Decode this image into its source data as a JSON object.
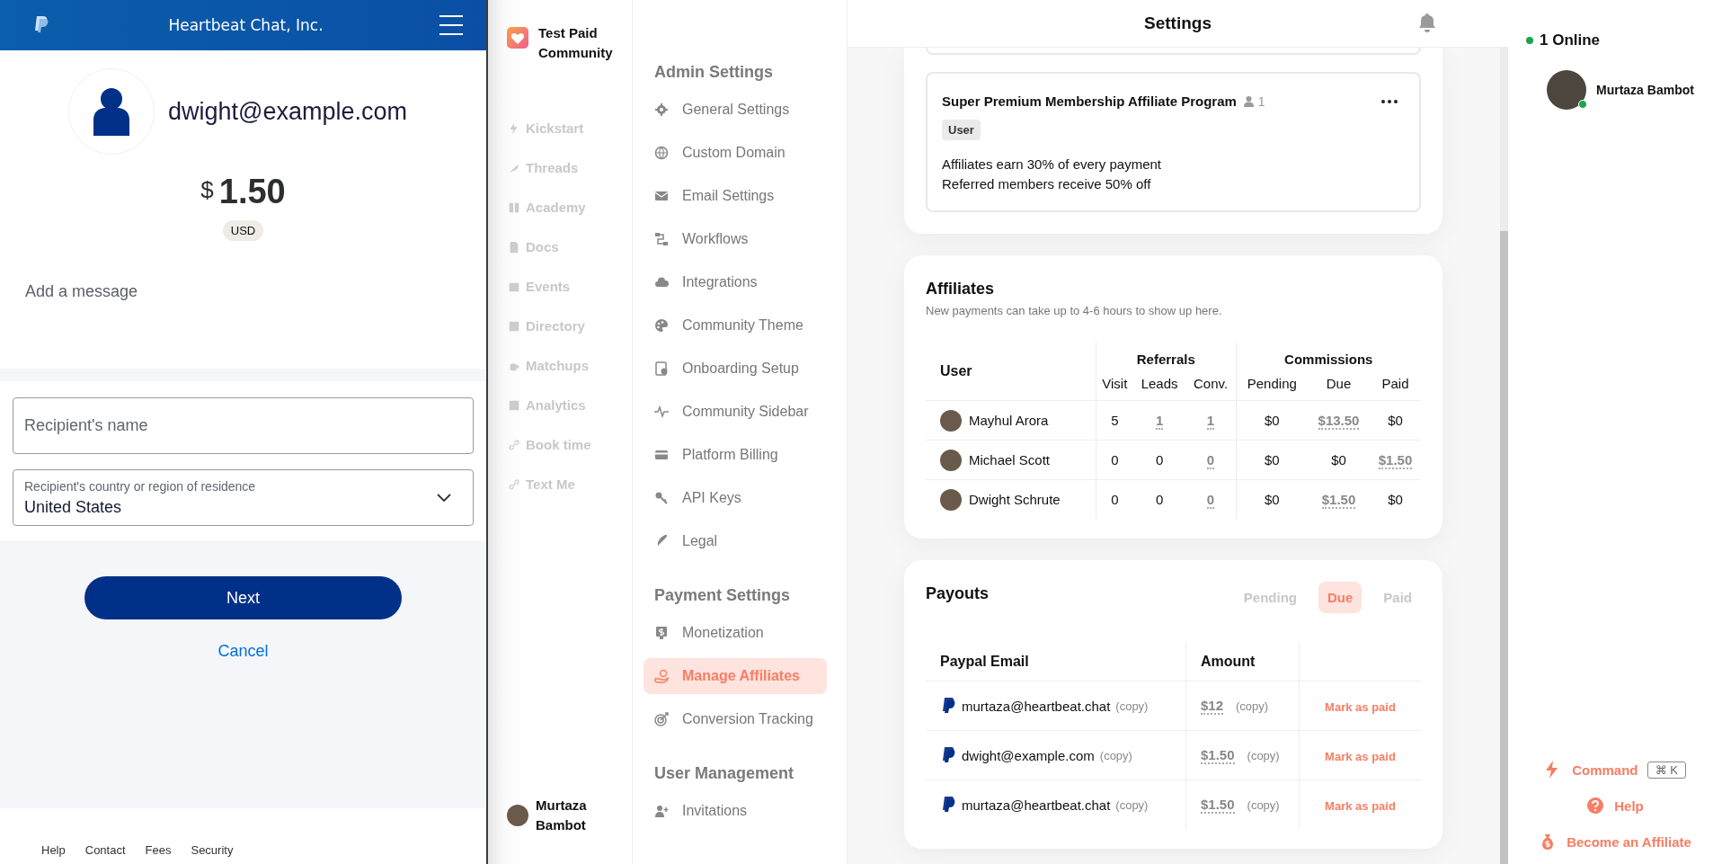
{
  "paypal": {
    "header_title": "Heartbeat Chat, Inc.",
    "recipient_email": "dwight@example.com",
    "currency_symbol": "$",
    "amount": "1.50",
    "currency": "USD",
    "message_placeholder": "Add a message",
    "name_field": {
      "placeholder": "Recipient's name"
    },
    "country_field": {
      "label": "Recipient's country or region of residence",
      "value": "United States"
    },
    "next_button": "Next",
    "cancel_link": "Cancel",
    "footer_links": [
      "Help",
      "Contact",
      "Fees",
      "Security"
    ]
  },
  "community": {
    "name": "Test Paid Community",
    "nav": [
      {
        "label": "Kickstart"
      },
      {
        "label": "Threads"
      },
      {
        "label": "Academy"
      },
      {
        "label": "Docs"
      },
      {
        "label": "Events"
      },
      {
        "label": "Directory"
      },
      {
        "label": "Matchups"
      },
      {
        "label": "Analytics"
      },
      {
        "label": "Book time"
      },
      {
        "label": "Text Me"
      }
    ],
    "user_name": "Murtaza Bambot"
  },
  "settings_menu": {
    "sections": [
      {
        "title": "Admin Settings",
        "items": [
          {
            "label": "General Settings",
            "selected": false
          },
          {
            "label": "Custom Domain",
            "selected": false
          },
          {
            "label": "Email Settings",
            "selected": false
          },
          {
            "label": "Workflows",
            "selected": false
          },
          {
            "label": "Integrations",
            "selected": false
          },
          {
            "label": "Community Theme",
            "selected": false
          },
          {
            "label": "Onboarding Setup",
            "selected": false
          },
          {
            "label": "Community Sidebar",
            "selected": false
          },
          {
            "label": "Platform Billing",
            "selected": false
          },
          {
            "label": "API Keys",
            "selected": false
          },
          {
            "label": "Legal",
            "selected": false
          }
        ]
      },
      {
        "title": "Payment Settings",
        "items": [
          {
            "label": "Monetization",
            "selected": false
          },
          {
            "label": "Manage Affiliates",
            "selected": true
          },
          {
            "label": "Conversion Tracking",
            "selected": false
          }
        ]
      },
      {
        "title": "User Management",
        "items": [
          {
            "label": "Invitations",
            "selected": false
          }
        ]
      }
    ]
  },
  "header": {
    "title": "Settings"
  },
  "program": {
    "title": "Super Premium Membership Affiliate Program",
    "member_count": "1",
    "tag": "User",
    "lines": [
      "Affiliates earn 30% of every payment",
      "Referred members receive 50% off"
    ]
  },
  "affiliates": {
    "title": "Affiliates",
    "subtitle": "New payments can take up to 4-6 hours to show up here.",
    "user_column": "User",
    "groups": [
      {
        "label": "Referrals",
        "columns": [
          "Visit",
          "Leads",
          "Conv."
        ]
      },
      {
        "label": "Commissions",
        "columns": [
          "Pending",
          "Due",
          "Paid"
        ]
      }
    ],
    "rows": [
      {
        "name": "Mayhul Arora",
        "cells": [
          {
            "text": "5",
            "dotted": false
          },
          {
            "text": "1",
            "dotted": true
          },
          {
            "text": "1",
            "dotted": true
          },
          {
            "text": "$0",
            "dotted": false
          },
          {
            "text": "$13.50",
            "dotted": true
          },
          {
            "text": "$0",
            "dotted": false
          }
        ]
      },
      {
        "name": "Michael Scott",
        "cells": [
          {
            "text": "0",
            "dotted": false
          },
          {
            "text": "0",
            "dotted": false
          },
          {
            "text": "0",
            "dotted": true
          },
          {
            "text": "$0",
            "dotted": false
          },
          {
            "text": "$0",
            "dotted": false
          },
          {
            "text": "$1.50",
            "dotted": true
          }
        ]
      },
      {
        "name": "Dwight Schrute",
        "cells": [
          {
            "text": "0",
            "dotted": false
          },
          {
            "text": "0",
            "dotted": false
          },
          {
            "text": "0",
            "dotted": true
          },
          {
            "text": "$0",
            "dotted": false
          },
          {
            "text": "$1.50",
            "dotted": true
          },
          {
            "text": "$0",
            "dotted": false
          }
        ]
      }
    ]
  },
  "payouts": {
    "title": "Payouts",
    "tabs": [
      {
        "label": "Pending",
        "selected": false
      },
      {
        "label": "Due",
        "selected": true
      },
      {
        "label": "Paid",
        "selected": false
      }
    ],
    "columns": [
      "Paypal Email",
      "Amount"
    ],
    "rows": [
      {
        "email": "murtaza@heartbeat.chat",
        "email_copy": "(copy)",
        "amount": "$12",
        "amount_copy": "(copy)",
        "action": "Mark as paid"
      },
      {
        "email": "dwight@example.com",
        "email_copy": "(copy)",
        "amount": "$1.50",
        "amount_copy": "(copy)",
        "action": "Mark as paid"
      },
      {
        "email": "murtaza@heartbeat.chat",
        "email_copy": "(copy)",
        "amount": "$1.50",
        "amount_copy": "(copy)",
        "action": "Mark as paid"
      }
    ]
  },
  "online": {
    "title": "1 Online",
    "users": [
      {
        "name": "Murtaza Bambot"
      }
    ],
    "actions": [
      {
        "kind": "command",
        "label": "Command",
        "shortcut": "⌘ K"
      },
      {
        "kind": "help",
        "label": "Help"
      },
      {
        "kind": "affiliate",
        "label": "Become an Affiliate"
      }
    ]
  }
}
